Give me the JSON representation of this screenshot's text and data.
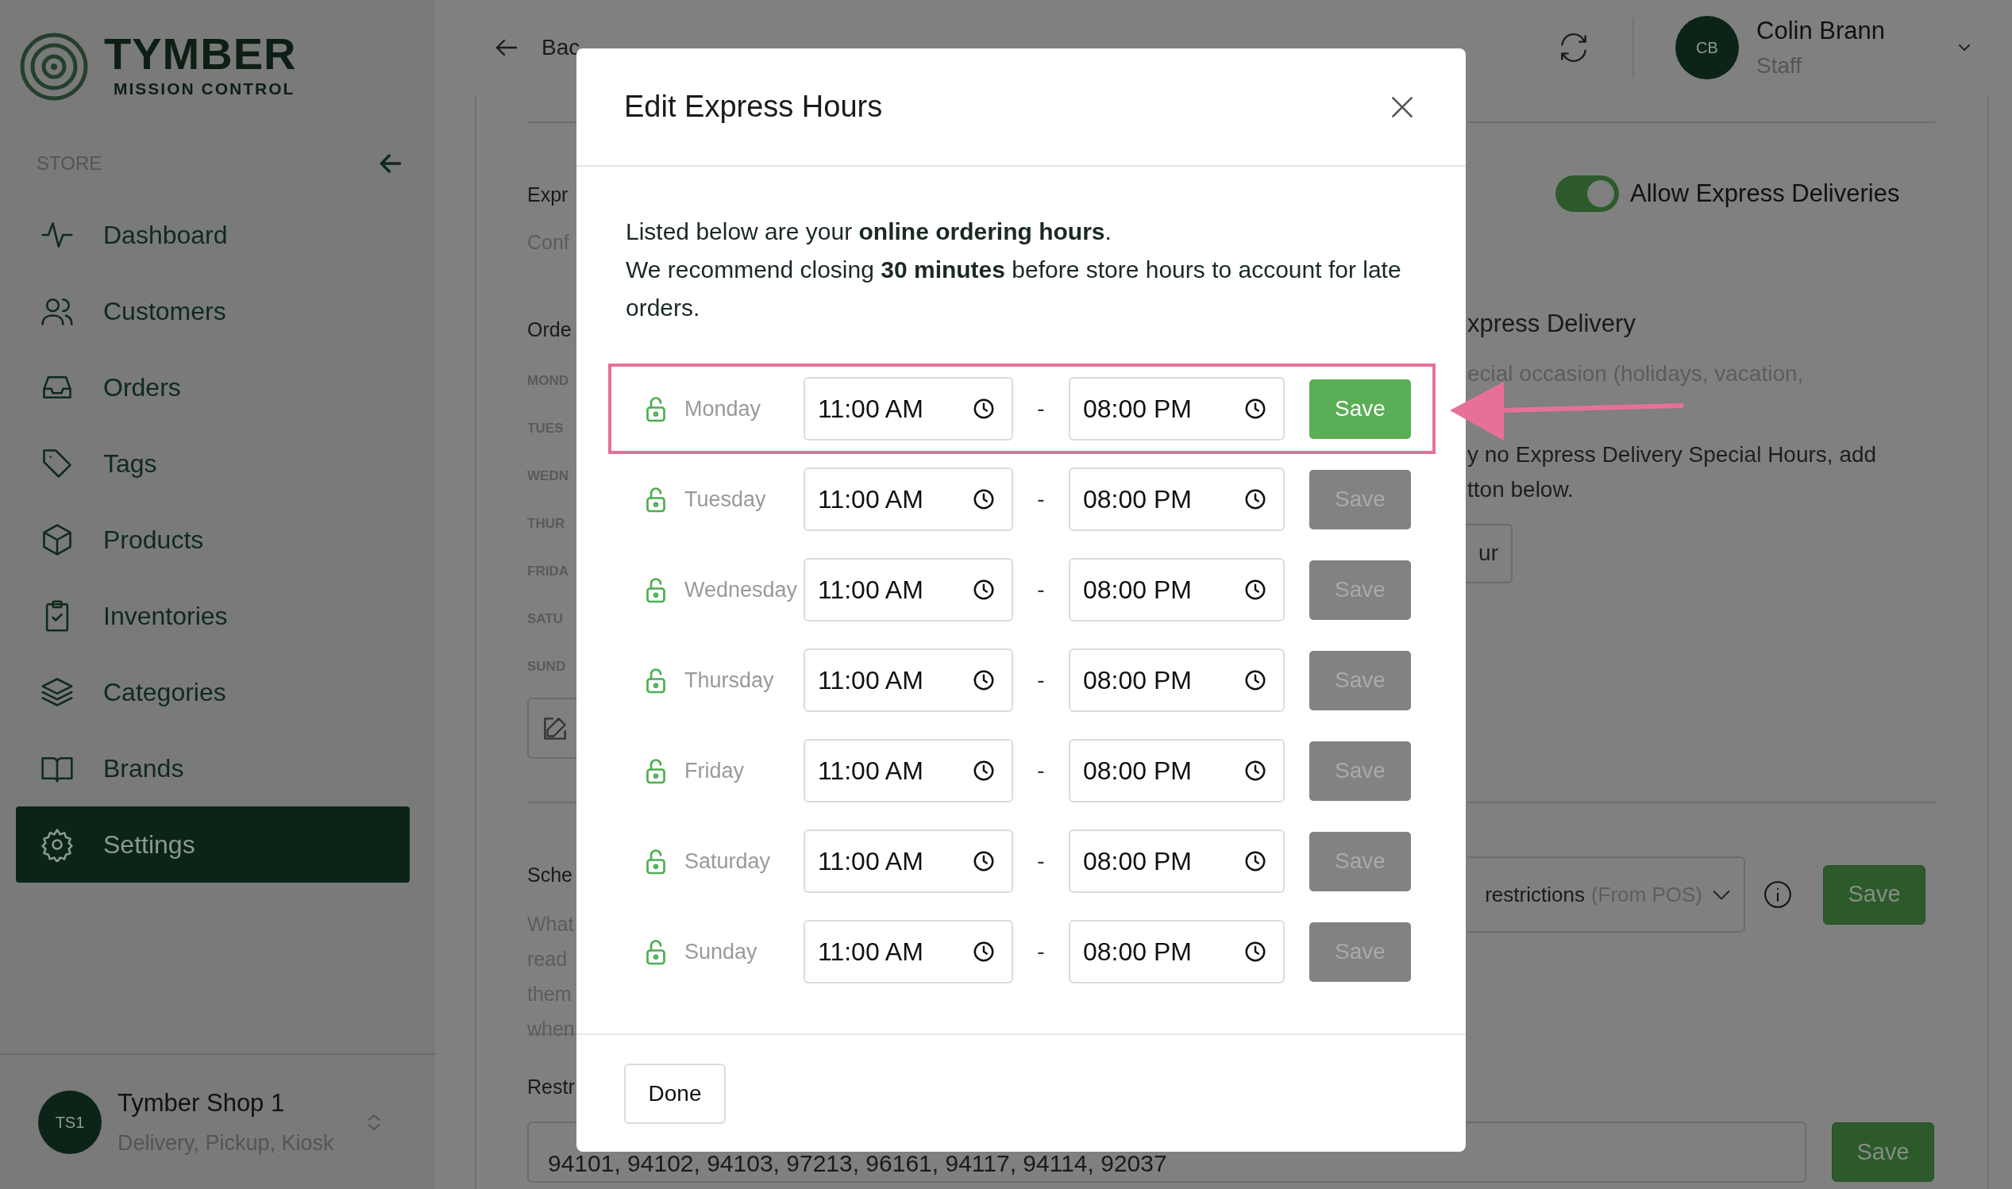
{
  "sidebar": {
    "logo": {
      "title": "TYMBER",
      "subtitle": "MISSION CONTROL"
    },
    "section_label": "STORE",
    "items": [
      {
        "label": "Dashboard",
        "selected": false
      },
      {
        "label": "Customers",
        "selected": false
      },
      {
        "label": "Orders",
        "selected": false
      },
      {
        "label": "Tags",
        "selected": false
      },
      {
        "label": "Products",
        "selected": false
      },
      {
        "label": "Inventories",
        "selected": false
      },
      {
        "label": "Categories",
        "selected": false
      },
      {
        "label": "Brands",
        "selected": false
      },
      {
        "label": "Settings",
        "selected": true
      }
    ],
    "store": {
      "initials": "TS1",
      "name": "Tymber Shop 1",
      "subtitle": "Delivery, Pickup, Kiosk"
    }
  },
  "header": {
    "back": "Bac",
    "user": {
      "initials": "CB",
      "name": "Colin Brann",
      "role": "Staff"
    }
  },
  "background": {
    "left_sections": [
      {
        "items": [
          {
            "kind": "heading",
            "text": "Expr"
          },
          {
            "kind": "muted",
            "text": "Conf"
          },
          {
            "kind": "heading",
            "text": "Orde"
          },
          {
            "kind": "day",
            "text": "MOND"
          },
          {
            "kind": "day",
            "text": "TUES"
          },
          {
            "kind": "day",
            "text": "WEDN"
          },
          {
            "kind": "day",
            "text": "THUR"
          },
          {
            "kind": "day",
            "text": "FRIDA"
          },
          {
            "kind": "day",
            "text": "SATU"
          },
          {
            "kind": "day",
            "text": "SUND"
          },
          {
            "kind": "edit"
          }
        ]
      },
      {
        "items": [
          {
            "kind": "heading",
            "text": "Sche"
          },
          {
            "kind": "paragraph",
            "lines": [
              "What",
              "read",
              "them",
              "when"
            ]
          }
        ]
      },
      {
        "items": [
          {
            "kind": "heading",
            "text": "Restr"
          }
        ]
      }
    ],
    "express_toggle": {
      "label": "Allow Express Deliveries",
      "on": true
    },
    "special": {
      "heading": "xpress Delivery",
      "description": "ecial occasion (holidays, vacation,",
      "lines": [
        "y no Express Delivery Special Hours, add",
        "tton below."
      ],
      "button": "ur"
    },
    "restriction_select": {
      "value": "restrictions",
      "hint": "(From POS)",
      "save": "Save"
    },
    "zip_field": {
      "value": "94101, 94102, 94103, 97213, 96161, 94117, 94114, 92037",
      "save": "Save"
    }
  },
  "modal": {
    "title": "Edit Express Hours",
    "intro": [
      "Listed below are your **online ordering hours**.",
      "We recommend closing **30 minutes** before store hours to account for late orders."
    ],
    "rows": [
      {
        "day": "Monday",
        "start": "11:00 AM",
        "separator": "-",
        "end": "08:00 PM",
        "save": "Save",
        "disabled": false,
        "highlighted": true
      },
      {
        "day": "Tuesday",
        "start": "11:00 AM",
        "separator": "-",
        "end": "08:00 PM",
        "save": "Save",
        "disabled": true,
        "highlighted": false
      },
      {
        "day": "Wednesday",
        "start": "11:00 AM",
        "separator": "-",
        "end": "08:00 PM",
        "save": "Save",
        "disabled": true,
        "highlighted": false
      },
      {
        "day": "Thursday",
        "start": "11:00 AM",
        "separator": "-",
        "end": "08:00 PM",
        "save": "Save",
        "disabled": true,
        "highlighted": false
      },
      {
        "day": "Friday",
        "start": "11:00 AM",
        "separator": "-",
        "end": "08:00 PM",
        "save": "Save",
        "disabled": true,
        "highlighted": false
      },
      {
        "day": "Saturday",
        "start": "11:00 AM",
        "separator": "-",
        "end": "08:00 PM",
        "save": "Save",
        "disabled": true,
        "highlighted": false
      },
      {
        "day": "Sunday",
        "start": "11:00 AM",
        "separator": "-",
        "end": "08:00 PM",
        "save": "Save",
        "disabled": true,
        "highlighted": false
      }
    ],
    "done": "Done"
  }
}
